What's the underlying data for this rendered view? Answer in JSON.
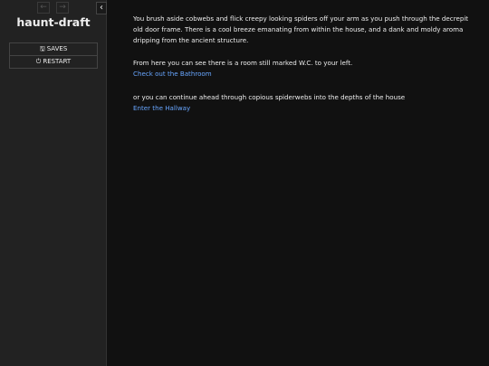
{
  "sidebar": {
    "story_title": "haunt-draft",
    "back_icon": "←",
    "forward_icon": "→",
    "collapse_icon": "‹",
    "saves_label": "SAVES",
    "saves_icon": "🖫",
    "restart_label": "RESTART",
    "restart_icon": "⏻"
  },
  "passage": {
    "intro": "You brush aside cobwebs and flick creepy looking spiders off your arm as you push through the decrepit old door frame. There is a cool breeze emanating from within the house, and a dank and moldy aroma dripping from the ancient structure.",
    "room_text": "From here you can see there is a room still marked W.C. to your left.",
    "bathroom_link": "Check out the Bathroom",
    "continue_text": "or you can continue ahead through copious spiderwebs into the depths of the house",
    "hallway_link": "Enter the Hallway"
  },
  "colors": {
    "page_bg": "#111111",
    "sidebar_bg": "#222222",
    "text": "#eeeeee",
    "link": "#68a6ff"
  }
}
